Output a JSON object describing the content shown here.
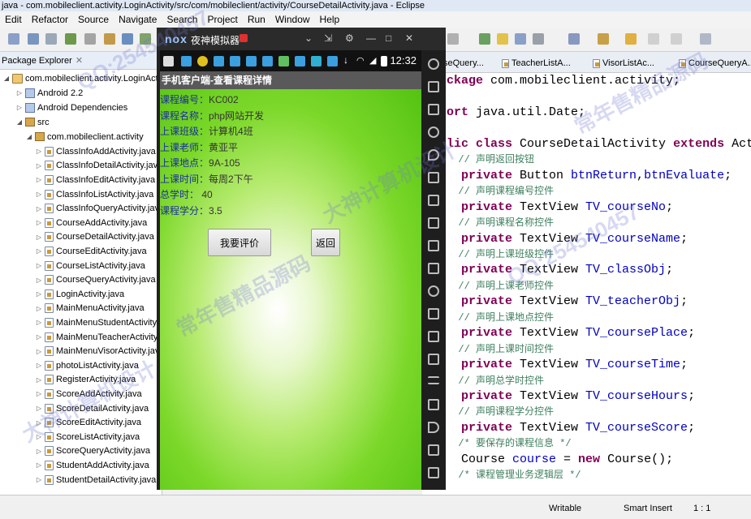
{
  "window": {
    "title": "java - com.mobileclient.activity.LoginActivity/src/com/mobileclient/activity/CourseDetailActivity.java - Eclipse"
  },
  "menu": [
    "Edit",
    "Refactor",
    "Source",
    "Navigate",
    "Search",
    "Project",
    "Run",
    "Window",
    "Help"
  ],
  "package_explorer": {
    "title": "Package Explorer",
    "project": "com.mobileclient.activity.LoginActivity",
    "android_lib": "Android 2.2",
    "deps": "Android Dependencies",
    "src": "src",
    "package": "com.mobileclient.activity",
    "files": [
      "ClassInfoAddActivity.java",
      "ClassInfoDetailActivity.java",
      "ClassInfoEditActivity.java",
      "ClassInfoListActivity.java",
      "ClassInfoQueryActivity.java",
      "CourseAddActivity.java",
      "CourseDetailActivity.java",
      "CourseEditActivity.java",
      "CourseListActivity.java",
      "CourseQueryActivity.java",
      "LoginActivity.java",
      "MainMenuActivity.java",
      "MainMenuStudentActivity.java",
      "MainMenuTeacherActivity.java",
      "MainMenuVisorActivity.java",
      "photoListActivity.java",
      "RegisterActivity.java",
      "ScoreAddActivity.java",
      "ScoreDetailActivity.java",
      "ScoreEditActivity.java",
      "ScoreListActivity.java",
      "ScoreQueryActivity.java",
      "StudentAddActivity.java",
      "StudentDetailActivity.java"
    ]
  },
  "editor": {
    "tabs": [
      "seQuery...",
      "TeacherListA...",
      "VisorListAc...",
      "CourseQueryA..."
    ],
    "lines": [
      [
        {
          "t": "ckage ",
          "c": "kw"
        },
        {
          "t": "com.mobileclient.activity;",
          "c": "ty"
        }
      ],
      [],
      [
        {
          "t": "ort ",
          "c": "kw"
        },
        {
          "t": "java.util.Date;",
          "c": "ty"
        }
      ],
      [],
      [
        {
          "t": "lic ",
          "c": "kw"
        },
        {
          "t": "class ",
          "c": "kw"
        },
        {
          "t": "CourseDetailActivity ",
          "c": "ty"
        },
        {
          "t": "extends ",
          "c": "kw"
        },
        {
          "t": "Act",
          "c": "ty"
        }
      ],
      [
        {
          "t": "  // 声明返回按钮",
          "c": "cm"
        }
      ],
      [
        {
          "t": "  private ",
          "c": "kw"
        },
        {
          "t": "Button ",
          "c": "ty"
        },
        {
          "t": "btnReturn",
          "c": "fd"
        },
        {
          "t": ",",
          "c": "ty"
        },
        {
          "t": "btnEvaluate",
          "c": "fd"
        },
        {
          "t": ";",
          "c": "ty"
        }
      ],
      [
        {
          "t": "  // 声明课程编号控件",
          "c": "cm"
        }
      ],
      [
        {
          "t": "  private ",
          "c": "kw"
        },
        {
          "t": "TextView ",
          "c": "ty"
        },
        {
          "t": "TV_courseNo",
          "c": "fd"
        },
        {
          "t": ";",
          "c": "ty"
        }
      ],
      [
        {
          "t": "  // 声明课程名称控件",
          "c": "cm"
        }
      ],
      [
        {
          "t": "  private ",
          "c": "kw"
        },
        {
          "t": "TextView ",
          "c": "ty"
        },
        {
          "t": "TV_courseName",
          "c": "fd"
        },
        {
          "t": ";",
          "c": "ty"
        }
      ],
      [
        {
          "t": "  // 声明上课班级控件",
          "c": "cm"
        }
      ],
      [
        {
          "t": "  private ",
          "c": "kw"
        },
        {
          "t": "TextView ",
          "c": "ty"
        },
        {
          "t": "TV_classObj",
          "c": "fd"
        },
        {
          "t": ";",
          "c": "ty"
        }
      ],
      [
        {
          "t": "  // 声明上课老师控件",
          "c": "cm"
        }
      ],
      [
        {
          "t": "  private ",
          "c": "kw"
        },
        {
          "t": "TextView ",
          "c": "ty"
        },
        {
          "t": "TV_teacherObj",
          "c": "fd"
        },
        {
          "t": ";",
          "c": "ty"
        }
      ],
      [
        {
          "t": "  // 声明上课地点控件",
          "c": "cm"
        }
      ],
      [
        {
          "t": "  private ",
          "c": "kw"
        },
        {
          "t": "TextView ",
          "c": "ty"
        },
        {
          "t": "TV_coursePlace",
          "c": "fd"
        },
        {
          "t": ";",
          "c": "ty"
        }
      ],
      [
        {
          "t": "  // 声明上课时间控件",
          "c": "cm"
        }
      ],
      [
        {
          "t": "  private ",
          "c": "kw"
        },
        {
          "t": "TextView ",
          "c": "ty"
        },
        {
          "t": "TV_courseTime",
          "c": "fd"
        },
        {
          "t": ";",
          "c": "ty"
        }
      ],
      [
        {
          "t": "  // 声明总学时控件",
          "c": "cm"
        }
      ],
      [
        {
          "t": "  private ",
          "c": "kw"
        },
        {
          "t": "TextView ",
          "c": "ty"
        },
        {
          "t": "TV_courseHours",
          "c": "fd"
        },
        {
          "t": ";",
          "c": "ty"
        }
      ],
      [
        {
          "t": "  // 声明课程学分控件",
          "c": "cm"
        }
      ],
      [
        {
          "t": "  private ",
          "c": "kw"
        },
        {
          "t": "TextView ",
          "c": "ty"
        },
        {
          "t": "TV_courseScore",
          "c": "fd"
        },
        {
          "t": ";",
          "c": "ty"
        }
      ],
      [
        {
          "t": "  /* 要保存的课程信息 */",
          "c": "cm"
        }
      ],
      [
        {
          "t": "  Course ",
          "c": "ty"
        },
        {
          "t": "course",
          "c": "fd"
        },
        {
          "t": " = ",
          "c": "ty"
        },
        {
          "t": "new ",
          "c": "kw"
        },
        {
          "t": "Course();",
          "c": "ty"
        }
      ],
      [
        {
          "t": "  /* 课程管理业务逻辑层 */",
          "c": "cm"
        }
      ]
    ]
  },
  "status": {
    "mode": "Writable",
    "insert": "Smart Insert",
    "position": "1 : 1"
  },
  "emulator": {
    "logo": "nox",
    "name": "夜神模拟器",
    "clock": "12:32",
    "app_title": "手机客户端-查看课程详情",
    "fields": [
      {
        "label": "课程编号：",
        "value": "KC002"
      },
      {
        "label": "课程名称：",
        "value": "php网站开发"
      },
      {
        "label": "上课班级：",
        "value": "计算机4班"
      },
      {
        "label": "上课老师：",
        "value": "黄亚平"
      },
      {
        "label": "上课地点：",
        "value": "9A-105"
      },
      {
        "label": "上课时间：",
        "value": "每周2下午"
      },
      {
        "label": "总学时：",
        "value": "  40"
      },
      {
        "label": "课程学分：",
        "value": "3.5"
      }
    ],
    "btn_evaluate": "我要评价",
    "btn_return": "返回"
  },
  "watermarks": [
    "QQ:254540457",
    "大神计算机设计",
    "常年售精品源码"
  ]
}
